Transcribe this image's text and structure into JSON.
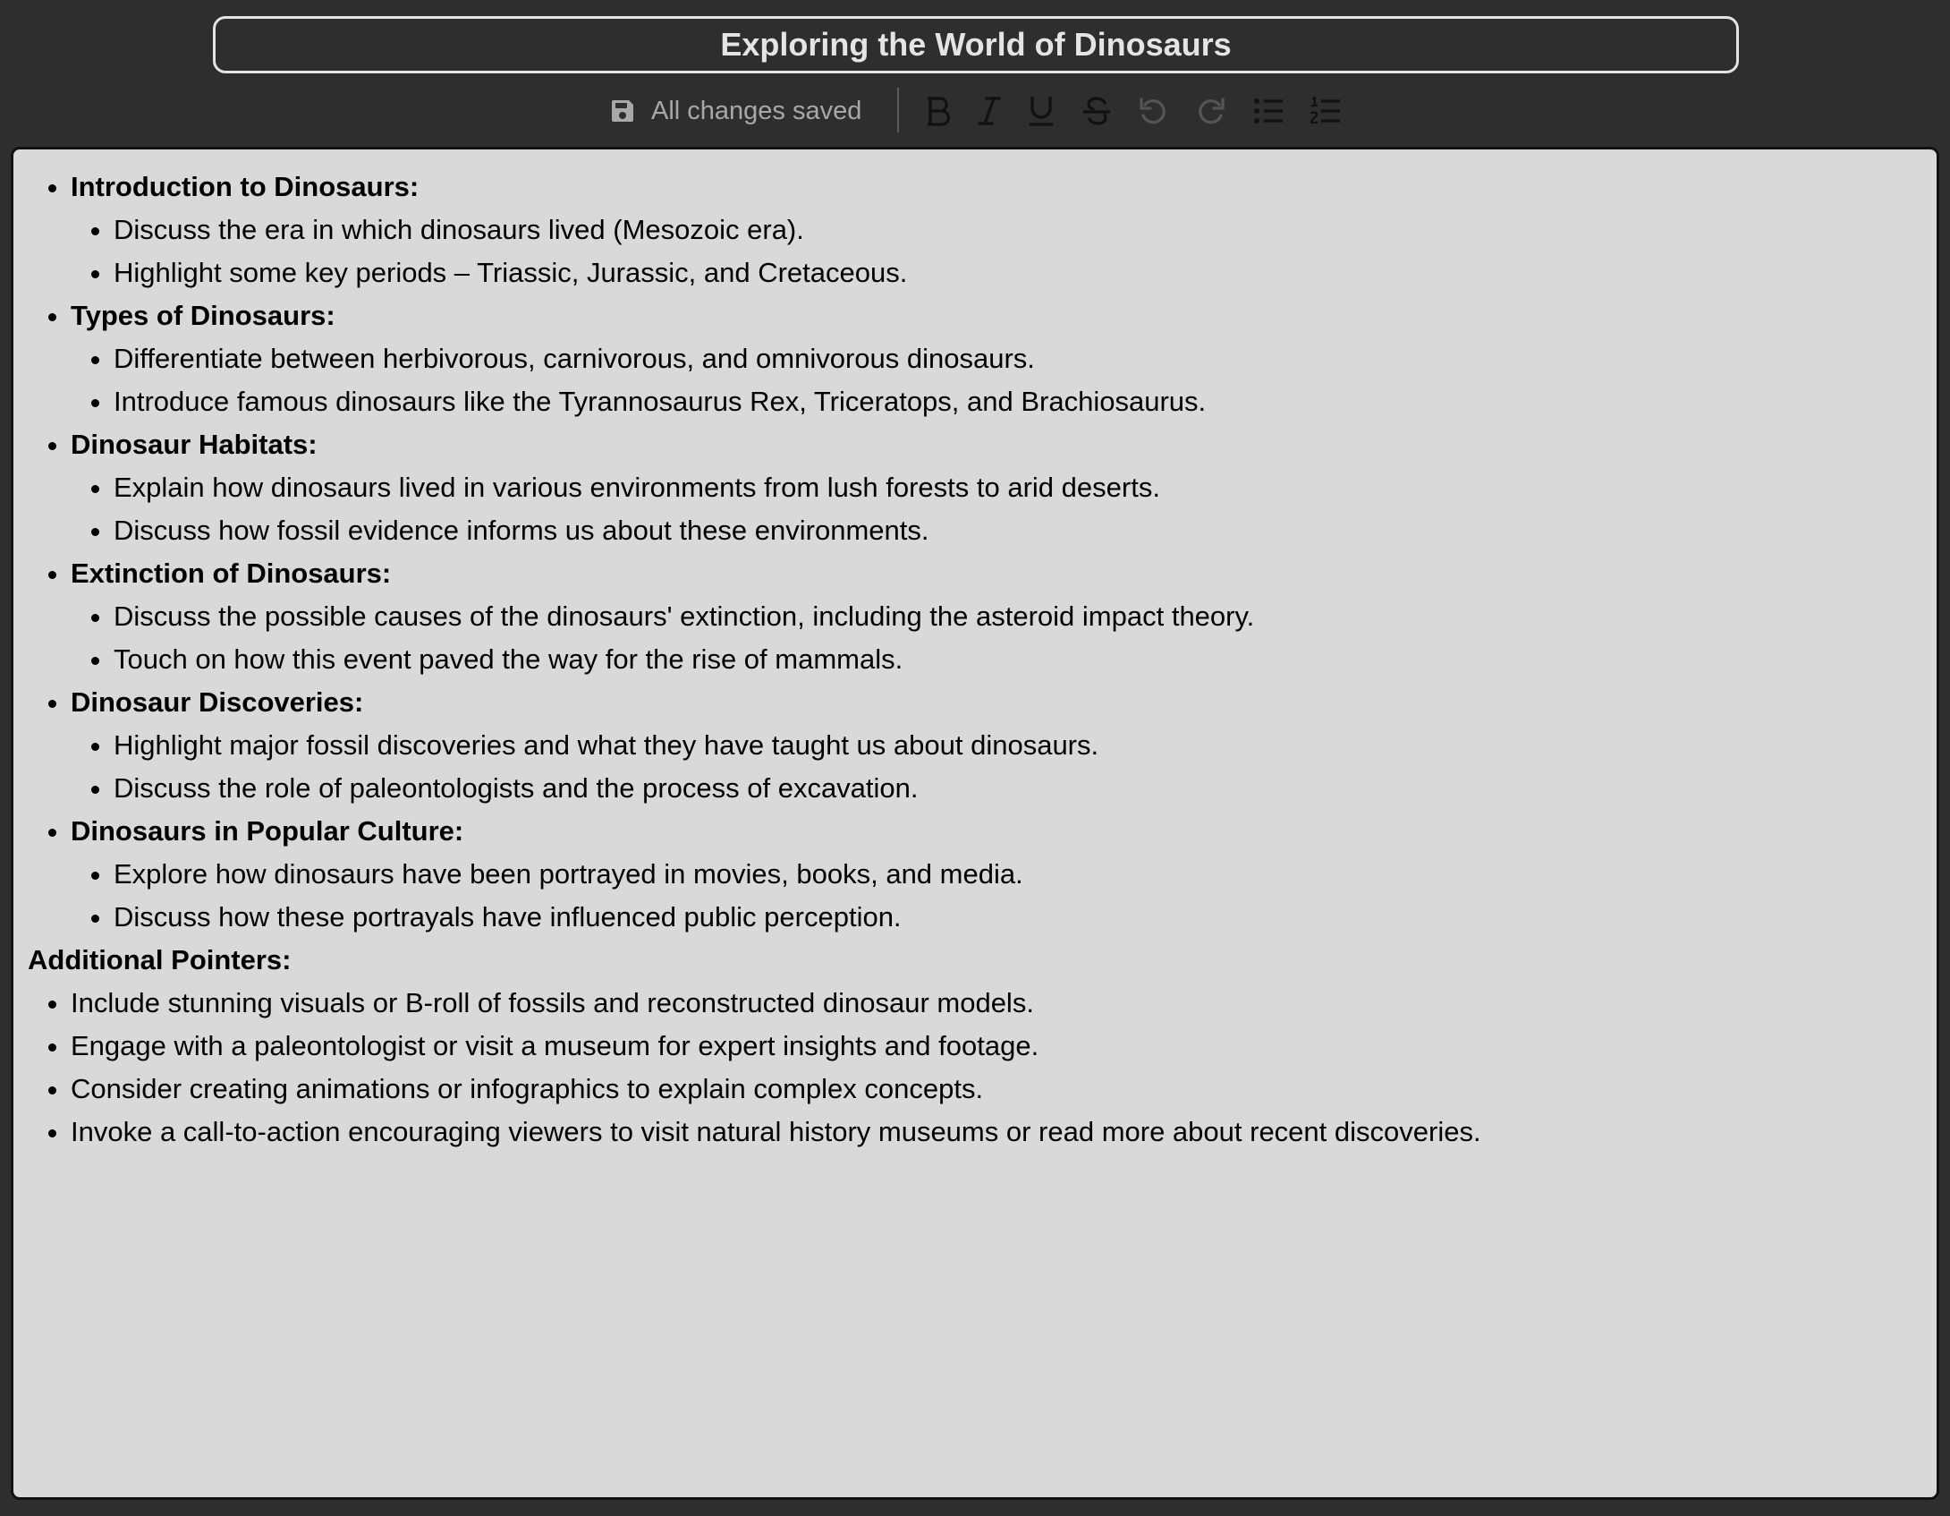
{
  "doc": {
    "title": "Exploring the World of Dinosaurs"
  },
  "toolbar": {
    "save_status": "All changes saved",
    "buttons": [
      {
        "name": "bold",
        "icon": "bold-icon"
      },
      {
        "name": "italic",
        "icon": "italic-icon"
      },
      {
        "name": "underline",
        "icon": "underline-icon"
      },
      {
        "name": "strikethrough",
        "icon": "strikethrough-icon"
      },
      {
        "name": "undo",
        "icon": "undo-icon"
      },
      {
        "name": "redo",
        "icon": "redo-icon"
      },
      {
        "name": "bullet-list",
        "icon": "bullet-list-icon"
      },
      {
        "name": "numbered-list",
        "icon": "numbered-list-icon"
      }
    ]
  },
  "content": {
    "sections": [
      {
        "title": "Introduction to Dinosaurs:",
        "items": [
          "Discuss the era in which dinosaurs lived (Mesozoic era).",
          "Highlight some key periods – Triassic, Jurassic, and Cretaceous."
        ]
      },
      {
        "title": "Types of Dinosaurs:",
        "items": [
          "Differentiate between herbivorous, carnivorous, and omnivorous dinosaurs.",
          "Introduce famous dinosaurs like the Tyrannosaurus Rex, Triceratops, and Brachiosaurus."
        ]
      },
      {
        "title": "Dinosaur Habitats:",
        "items": [
          "Explain how dinosaurs lived in various environments from lush forests to arid deserts.",
          "Discuss how fossil evidence informs us about these environments."
        ]
      },
      {
        "title": "Extinction of Dinosaurs:",
        "items": [
          "Discuss the possible causes of the dinosaurs' extinction, including the asteroid impact theory.",
          "Touch on how this event paved the way for the rise of mammals."
        ]
      },
      {
        "title": "Dinosaur Discoveries:",
        "items": [
          "Highlight major fossil discoveries and what they have taught us about dinosaurs.",
          "Discuss the role of paleontologists and the process of excavation."
        ]
      },
      {
        "title": "Dinosaurs in Popular Culture:",
        "items": [
          "Explore how dinosaurs have been portrayed in movies, books, and media.",
          "Discuss how these portrayals have influenced public perception."
        ]
      }
    ],
    "additional_title": "Additional Pointers:",
    "additional_items": [
      "Include stunning visuals or B-roll of fossils and reconstructed dinosaur models.",
      "Engage with a paleontologist or visit a museum for expert insights and footage.",
      "Consider creating animations or infographics to explain complex concepts.",
      "Invoke a call-to-action encouraging viewers to visit natural history museums or read more about recent discoveries."
    ]
  }
}
